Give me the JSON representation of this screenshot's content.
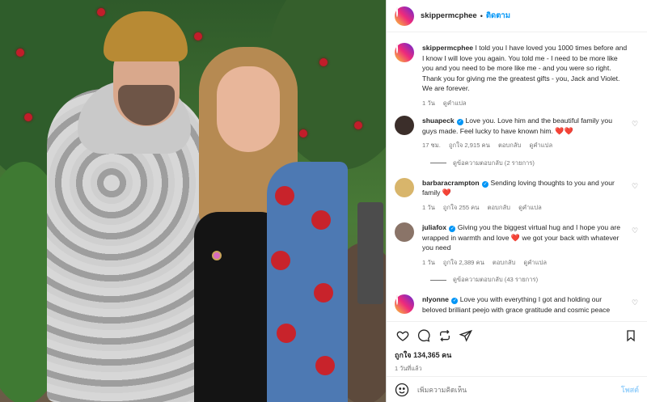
{
  "header": {
    "username": "skippermcphee",
    "separator": "•",
    "follow_label": "ติดตาม"
  },
  "caption": {
    "username": "skippermcphee",
    "text": "I told you I have loved you 1000 times before and I know I will love you again. You told me - I need to be more like you and you need to be more like me - and you were so right. Thank you for giving me the greatest gifts - you, Jack and Violet. We are forever.",
    "time": "1 วัน",
    "translate": "ดูคำแปล"
  },
  "comments": [
    {
      "username": "shuapeck",
      "verified": true,
      "text": "Love you. Love him and the beautiful family you guys made. Feel lucky to have known him.",
      "emoji": "❤️❤️",
      "time": "17 ชม.",
      "likes": "ถูกใจ 2,915 คน",
      "reply": "ตอบกลับ",
      "translate": "ดูคำแปล",
      "replies": "ดูข้อความตอบกลับ (2 รายการ)"
    },
    {
      "username": "barbaracrampton",
      "verified": true,
      "text": "Sending loving thoughts to you and your family",
      "emoji": "❤️",
      "time": "1 วัน",
      "likes": "ถูกใจ 255 คน",
      "reply": "ตอบกลับ",
      "translate": "ดูคำแปล",
      "replies": ""
    },
    {
      "username": "juliafox",
      "verified": true,
      "text": "Giving you the biggest virtual hug and I hope you are wrapped in warmth and love",
      "emoji": "❤️",
      "text2": "we got your back with whatever you need",
      "time": "1 วัน",
      "likes": "ถูกใจ 2,389 คน",
      "reply": "ตอบกลับ",
      "translate": "ดูคำแปล",
      "replies": "ดูข้อความตอบกลับ (43 รายการ)"
    },
    {
      "username": "nlyonne",
      "verified": true,
      "text": "Love you with everything I got and holding our beloved brilliant peejo with grace gratitude and cosmic peace",
      "time": "",
      "likes": "",
      "reply": "",
      "translate": "",
      "replies": ""
    }
  ],
  "actions": {
    "icons": [
      "heart-icon",
      "comment-icon",
      "repost-icon",
      "share-icon",
      "bookmark-icon"
    ],
    "likes": "ถูกใจ 134,365 คน",
    "time": "1 วันที่แล้ว"
  },
  "add_comment": {
    "placeholder": "เพิ่มความคิดเห็น",
    "post_label": "โพสต์"
  },
  "colors": {
    "link": "#0095f6",
    "muted": "#737373",
    "heart": "#d42a36",
    "post_disabled": "#9cd2fb"
  }
}
